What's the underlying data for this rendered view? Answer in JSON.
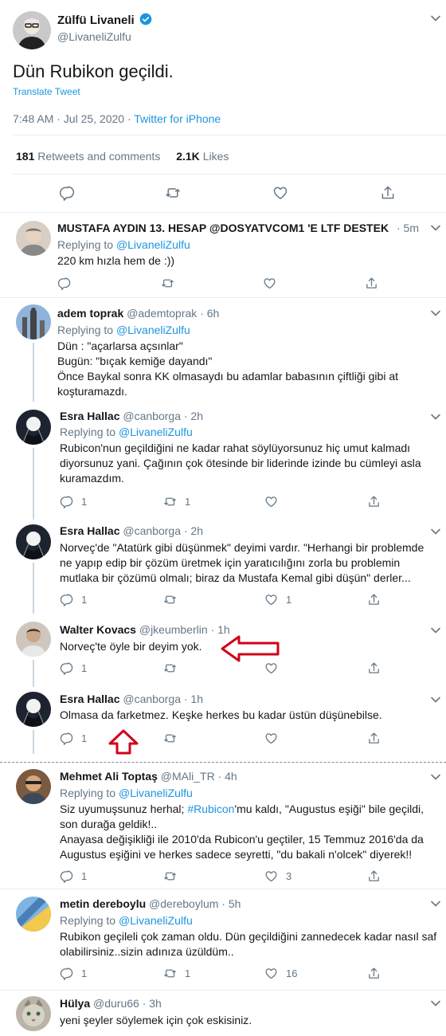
{
  "main_tweet": {
    "display_name": "Zülfü Livaneli",
    "handle": "@LivaneliZulfu",
    "text": "Dün Rubikon geçildi.",
    "translate_label": "Translate Tweet",
    "time": "7:48 AM · Jul 25, 2020 · ",
    "source": "Twitter for iPhone",
    "retweets_count": "181",
    "retweets_label": "Retweets and comments",
    "likes_count": "2.1K",
    "likes_label": "Likes"
  },
  "icons": {
    "reply": "reply-icon",
    "retweet": "retweet-icon",
    "like": "like-icon",
    "share": "share-icon",
    "verified": "verified-badge-icon",
    "chevron": "chevron-down-icon"
  },
  "colors": {
    "accent": "#1b95e0",
    "muted": "#657786",
    "text": "#14171a",
    "annotation_red": "#d0021b"
  },
  "replies": [
    {
      "name": "MUSTAFA AYDIN 13. HESAP @DOSYATVCOM1 'E LTF DESTEK",
      "handle": "",
      "time": "· 5m",
      "replying_prefix": "Replying to ",
      "replying_to": "@LivaneliZulfu",
      "lines": [
        "220 km hızla hem de :))"
      ],
      "reply_count": "",
      "retweet_count": "",
      "like_count": ""
    },
    {
      "name": "adem toprak",
      "handle": "@ademtoprak",
      "time": "· 6h",
      "replying_prefix": "Replying to ",
      "replying_to": "@LivaneliZulfu",
      "lines": [
        "Dün : \"açarlarsa açsınlar\"",
        "Bugün: \"bıçak kemiğe dayandı\"",
        "Önce Baykal sonra KK olmasaydı bu adamlar babasının çiftliği gibi at",
        "koşturamazdı."
      ]
    },
    {
      "name": "Esra Hallac",
      "handle": "@canborga",
      "time": "· 2h",
      "replying_prefix": "Replying to ",
      "replying_to": "@LivaneliZulfu",
      "lines": [
        "Rubicon'nun geçildiğini ne kadar rahat söylüyorsunuz hiç umut kalmadı",
        "diyorsunuz yani. Çağının çok ötesinde bir liderinde izinde bu cümleyi asla",
        "kuramazdım."
      ],
      "reply_count": "1",
      "retweet_count": "1",
      "like_count": ""
    },
    {
      "name": "Esra Hallac",
      "handle": "@canborga",
      "time": "· 2h",
      "lines": [
        "Norveç'de \"Atatürk gibi düşünmek\" deyimi vardır.  \"Herhangi bir problemde",
        "ne yapıp edip bir çözüm üretmek için yaratıcılığını zorla bu problemin",
        "mutlaka bir çözümü olmalı; biraz da Mustafa Kemal gibi düşün\" derler..."
      ],
      "reply_count": "1",
      "retweet_count": "",
      "like_count": "1"
    },
    {
      "name": "Walter Kovacs",
      "handle": "@jkeumberlin",
      "time": "· 1h",
      "lines": [
        "Norveç'te öyle bir deyim yok."
      ],
      "reply_count": "1",
      "retweet_count": "",
      "like_count": ""
    },
    {
      "name": "Esra Hallac",
      "handle": "@canborga",
      "time": "· 1h",
      "lines": [
        "Olmasa da farketmez. Keşke herkes bu kadar üstün düşünebilse."
      ],
      "reply_count": "1",
      "retweet_count": "",
      "like_count": ""
    },
    {
      "name": "Mehmet Ali Toptaş",
      "handle": "@MAli_TR",
      "time": "· 4h",
      "replying_prefix": "Replying to ",
      "replying_to": "@LivaneliZulfu",
      "line1_pre": "Siz uyumuşsunuz herhal; ",
      "line1_tag": "#Rubicon",
      "line1_post": "'mu kaldı, \"Augustus eşiği\" bile geçildi,",
      "lines": [
        "son durağa geldik!..",
        "Anayasa değişikliği ile 2010'da Rubicon'u geçtiler, 15 Temmuz 2016'da da",
        "Augustus eşiğini ve herkes sadece seyretti, \"du bakali n'olcek\" diyerek!!"
      ],
      "reply_count": "1",
      "retweet_count": "",
      "like_count": "3"
    },
    {
      "name": "metin dereboylu",
      "handle": "@dereboylum",
      "time": "· 5h",
      "replying_prefix": "Replying to ",
      "replying_to": "@LivaneliZulfu",
      "lines": [
        "Rubikon geçileli çok zaman oldu. Dün geçildiğini zannedecek kadar nasıl saf",
        "olabilirsiniz..sizin adınıza üzüldüm.."
      ],
      "reply_count": "1",
      "retweet_count": "1",
      "like_count": "16"
    },
    {
      "name": "Hülya",
      "handle": "@duru66",
      "time": "· 3h",
      "lines": [
        "yeni şeyler söylemek için çok eskisiniz."
      ]
    }
  ]
}
